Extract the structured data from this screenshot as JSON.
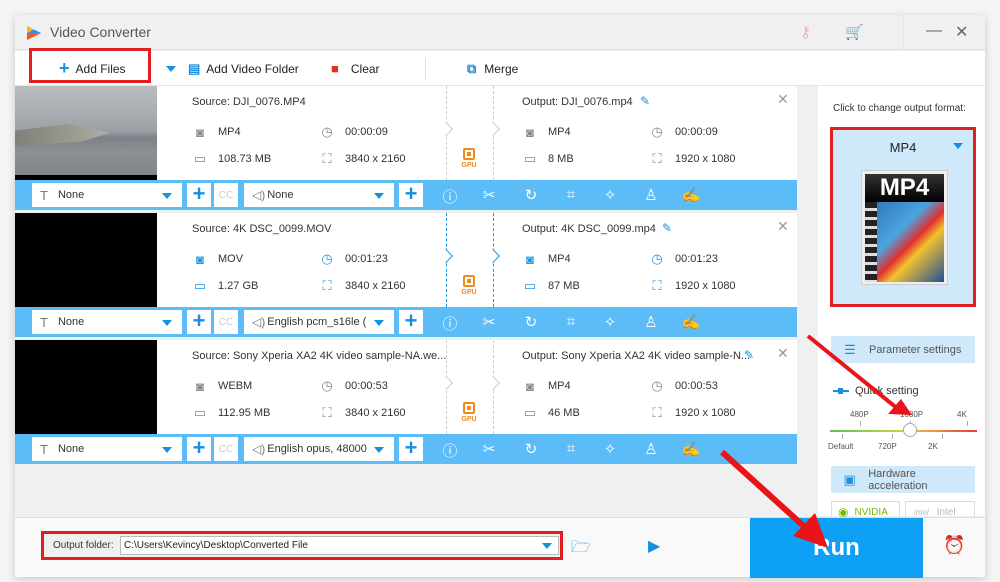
{
  "window": {
    "title": "Video Converter",
    "icons": {
      "key": "key-icon",
      "cart": "cart-icon",
      "minimize": "—",
      "close": "✕"
    }
  },
  "toolbar": {
    "add_files": "Add Files",
    "add_video_folder": "Add Video Folder",
    "clear": "Clear",
    "merge": "Merge"
  },
  "items": [
    {
      "source": "Source: DJI_0076.MP4",
      "output": "Output: DJI_0076.mp4",
      "src_format": "MP4",
      "src_duration": "00:00:09",
      "src_size": "108.73 MB",
      "src_resolution": "3840 x 2160",
      "out_format": "MP4",
      "out_duration": "00:00:09",
      "out_size": "8 MB",
      "out_resolution": "1920 x 1080",
      "gpu_label": "GPU",
      "subtitle": "None",
      "audio": "None",
      "active": false
    },
    {
      "source": "Source: 4K DSC_0099.MOV",
      "output": "Output: 4K DSC_0099.mp4",
      "src_format": "MOV",
      "src_duration": "00:01:23",
      "src_size": "1.27 GB",
      "src_resolution": "3840 x 2160",
      "out_format": "MP4",
      "out_duration": "00:01:23",
      "out_size": "87 MB",
      "out_resolution": "1920 x 1080",
      "gpu_label": "GPU",
      "subtitle": "None",
      "audio": "English pcm_s16le (",
      "active": true
    },
    {
      "source": "Source: Sony Xperia XA2 4K video sample-NA.we...",
      "output": "Output: Sony Xperia XA2 4K video sample-N...",
      "src_format": "WEBM",
      "src_duration": "00:00:53",
      "src_size": "112.95 MB",
      "src_resolution": "3840 x 2160",
      "out_format": "MP4",
      "out_duration": "00:00:53",
      "out_size": "46 MB",
      "out_resolution": "1920 x 1080",
      "gpu_label": "GPU",
      "subtitle": "None",
      "audio": "English opus, 48000",
      "active": false
    }
  ],
  "right_panel": {
    "change_format_label": "Click to change output format:",
    "format": "MP4",
    "format_image_text": "MP4",
    "parameter_settings": "Parameter settings",
    "quick_setting": "Quick setting",
    "quality_top_labels": [
      "480P",
      "1080P",
      "4K"
    ],
    "quality_bottom_labels": [
      "Default",
      "720P",
      "2K"
    ],
    "quality_selected": "1080P",
    "hardware_acceleration": "Hardware acceleration",
    "nvidia": "NVIDIA",
    "intel": "Intel"
  },
  "bottom": {
    "output_folder_label": "Output folder:",
    "output_folder_value": "C:\\Users\\Kevincy\\Desktop\\Converted File",
    "run": "Run"
  },
  "colors": {
    "accent": "#1a8fe0",
    "toolbar_bar": "#5bbcf7",
    "run_button": "#0ea0f5",
    "highlight_red": "#e02020",
    "gpu_orange": "#f08a1a"
  }
}
